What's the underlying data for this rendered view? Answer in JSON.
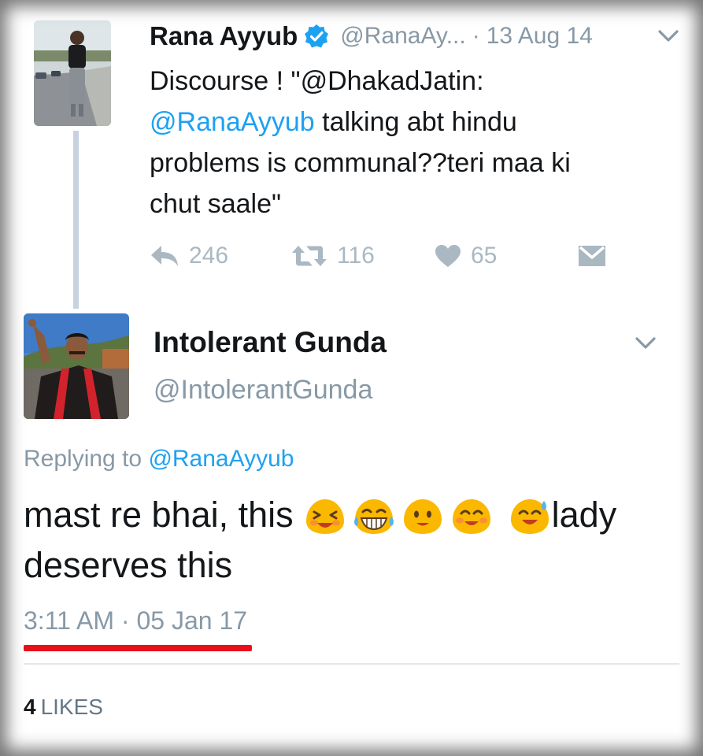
{
  "tweet1": {
    "author_name": "Rana Ayyub",
    "handle": "@RanaAy...",
    "separator": "·",
    "date": "13 Aug 14",
    "verified": true,
    "text_lines": [
      "Discourse ! \"@DhakadJatin:",
      "@RanaAyyub",
      " talking abt hindu",
      "problems is communal??teri maa ki",
      "chut saale\""
    ],
    "actions": {
      "reply_count": "246",
      "retweet_count": "116",
      "like_count": "65"
    }
  },
  "tweet2": {
    "author_name": "Intolerant Gunda",
    "handle": "@IntolerantGunda",
    "replying_prefix": "Replying to ",
    "replying_handle": "@RanaAyyub",
    "text_part1": "mast re bhai, this",
    "text_part2": "lady",
    "text_line2": "deserves this",
    "emojis": [
      "laughing-squint",
      "grinning-tears",
      "smiling",
      "smiling-eyes",
      "sweat-smile"
    ],
    "timestamp": "3:11 AM · 05 Jan 17",
    "likes_count": "4",
    "likes_label": "LIKES"
  },
  "colors": {
    "link": "#1da1f2",
    "muted": "#8899a6",
    "action": "#aab8c2",
    "text": "#14171a",
    "underline": "#e8101a",
    "emoji": "#fbb800"
  }
}
